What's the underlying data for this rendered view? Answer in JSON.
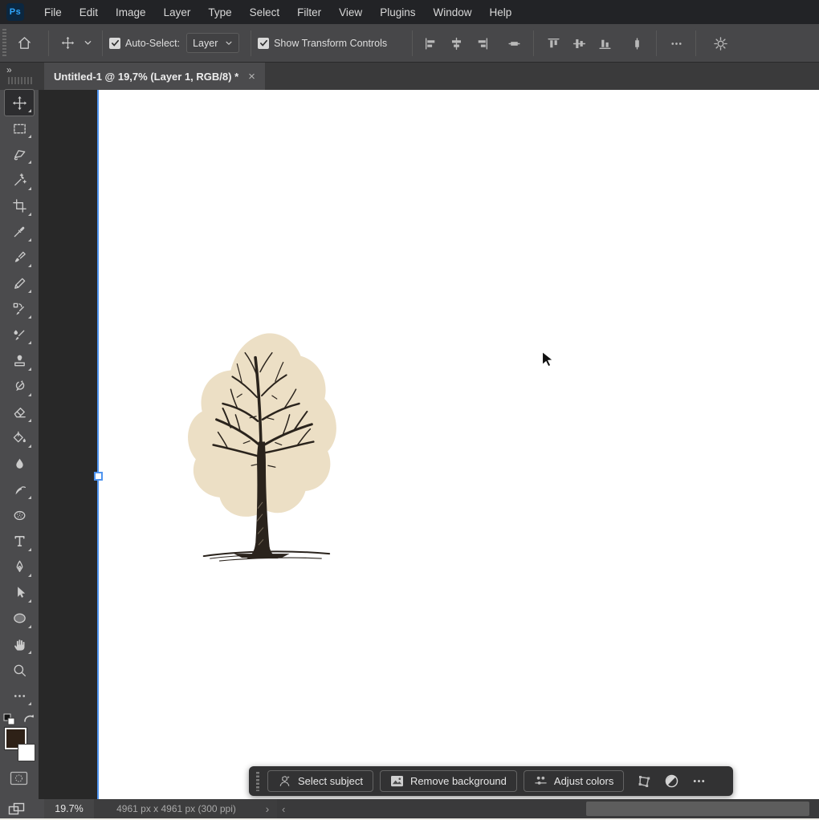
{
  "app": {
    "logo_text": "Ps"
  },
  "menubar": {
    "items": [
      "File",
      "Edit",
      "Image",
      "Layer",
      "Type",
      "Select",
      "Filter",
      "View",
      "Plugins",
      "Window",
      "Help"
    ]
  },
  "options": {
    "check_glyph": "✓",
    "auto_select_label": "Auto-Select:",
    "auto_select_checked": true,
    "target_value": "Layer",
    "show_transform_label": "Show Transform Controls",
    "show_transform_checked": true,
    "icons": [
      "home-icon",
      "move-tool-icon",
      "chevron-down-icon",
      "align-left-edges-icon",
      "align-horizontal-centers-icon",
      "align-right-edges-icon",
      "distribute-vertical-centers-icon",
      "align-top-edges-icon",
      "align-vertical-centers-icon",
      "align-bottom-edges-icon",
      "distribute-horizontal-centers-icon",
      "more-options-icon",
      "gear-icon"
    ]
  },
  "panel": {
    "collapse_glyph": "»"
  },
  "tab": {
    "title": "Untitled-1 @ 19,7% (Layer 1, RGB/8) *",
    "close_glyph": "×"
  },
  "toolbar": {
    "selected_tool": "move-tool",
    "tools": [
      "move-tool",
      "rectangular-marquee-tool",
      "lasso-tool",
      "magic-wand-tool",
      "crop-tool",
      "eyedropper-tool",
      "brush-tool",
      "pencil-tool",
      "color-replacement-tool",
      "mixer-brush-tool",
      "clone-stamp-tool",
      "history-brush-tool",
      "eraser-tool",
      "paint-bucket-tool",
      "blur-tool",
      "smudge-tool",
      "sponge-tool",
      "type-tool",
      "pen-tool",
      "path-selection-tool",
      "ellipse-tool",
      "hand-tool",
      "zoom-tool",
      "more-tools"
    ],
    "foreground_color": "#2e2117",
    "background_color": "#ffffff"
  },
  "canvas": {
    "background": "#ffffff",
    "transform_edge_color": "#4f94ef",
    "artwork": "hand-drawn bare tree illustration with beige foliage blob, dark trunk and ground stroke",
    "artwork_colors": {
      "foliage_blob": "#ecdfc5",
      "branches": "#2a231c"
    }
  },
  "taskbar": {
    "buttons": [
      {
        "icon": "select-subject-icon",
        "label": "Select subject"
      },
      {
        "icon": "remove-background-icon",
        "label": "Remove background"
      },
      {
        "icon": "adjust-colors-icon",
        "label": "Adjust colors"
      }
    ],
    "icons": [
      "transform-image-icon",
      "adjustment-contrast-icon",
      "more-icon"
    ]
  },
  "status": {
    "zoom_level": "19.7%",
    "document_info": "4961 px x 4961 px (300 ppi)",
    "expand_glyph": "›",
    "scroll_left_glyph": "‹"
  }
}
